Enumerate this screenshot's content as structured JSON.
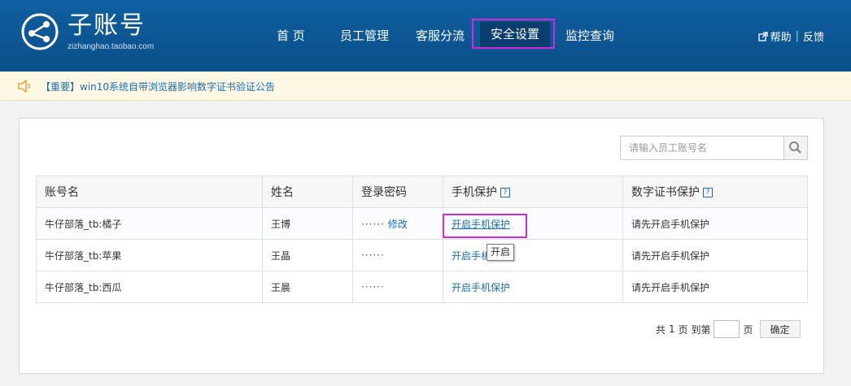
{
  "header": {
    "logo_title": "子账号",
    "logo_subtitle": "zizhanghao.taobao.com",
    "nav": [
      "首 页",
      "员工管理",
      "客服分流",
      "安全设置",
      "监控查询"
    ],
    "help_label": "帮助",
    "feedback_label": "反馈"
  },
  "notice": {
    "text": "【重要】win10系统自带浏览器影响数字证书验证公告"
  },
  "search": {
    "placeholder": "请输入员工账号名"
  },
  "table": {
    "headers": [
      "账号名",
      "姓名",
      "登录密码",
      "手机保护",
      "数字证书保护"
    ],
    "help_mark": "?",
    "rows": [
      {
        "account": "牛仔部落_tb:橘子",
        "name": "王博",
        "password": "······",
        "password_action": "修改",
        "phone": "开启手机保护",
        "cert": "请先开启手机保护"
      },
      {
        "account": "牛仔部落_tb:苹果",
        "name": "王晶",
        "password": "······",
        "password_action": "",
        "phone": "开启手机",
        "cert": "请先开启手机保护"
      },
      {
        "account": "牛仔部落_tb:西瓜",
        "name": "王晨",
        "password": "······",
        "password_action": "",
        "phone": "开启手机保护",
        "cert": "请先开启手机保护"
      }
    ]
  },
  "tooltip": {
    "text": "开启"
  },
  "pager": {
    "total_prefix": "共",
    "total_pages": "1",
    "total_suffix": "页 到第",
    "page_suffix": "页",
    "confirm_label": "确定"
  },
  "colors": {
    "header_bg": "#0f5fa0",
    "link": "#1a6fb3",
    "highlight": "#d02bd8",
    "notice_bg": "#fdf8e4"
  }
}
